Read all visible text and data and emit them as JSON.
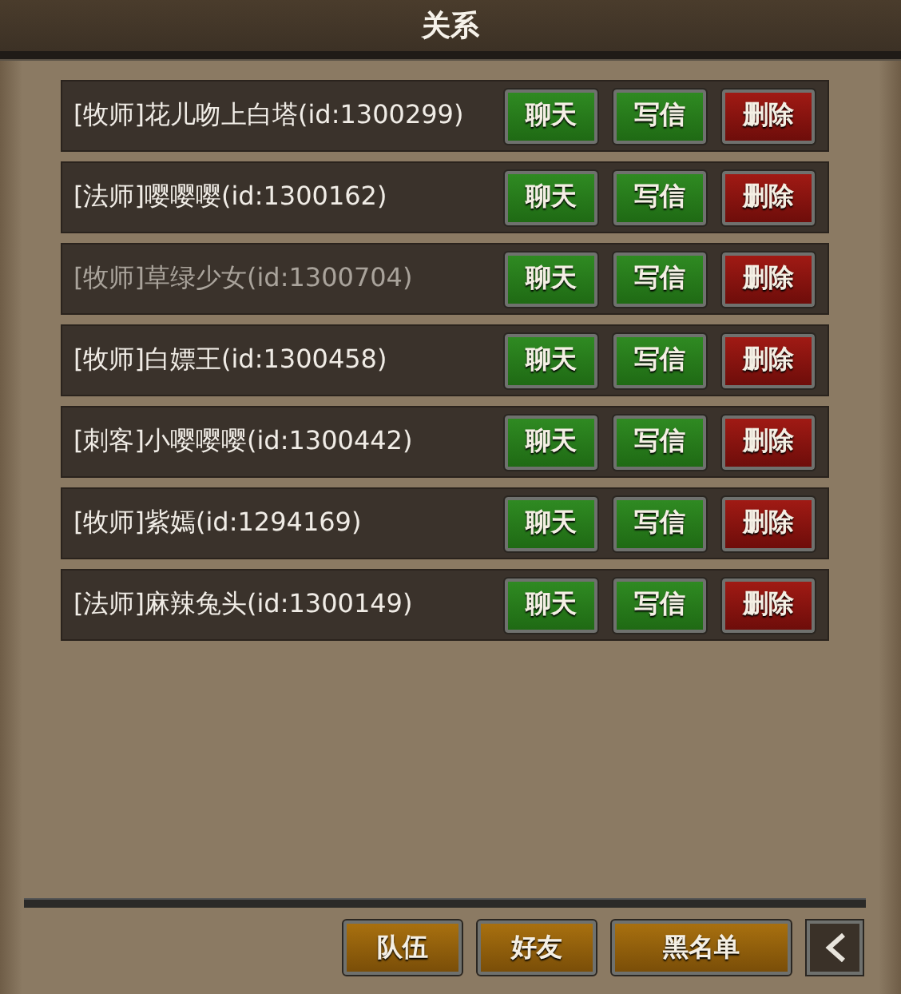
{
  "window": {
    "title": "关系"
  },
  "friends": [
    {
      "name": "[牧师]花儿吻上白塔(id:1300299)",
      "online": true,
      "actions": [
        {
          "label": "聊天",
          "kind": "chat"
        },
        {
          "label": "写信",
          "kind": "mail"
        },
        {
          "label": "删除",
          "kind": "delete"
        }
      ]
    },
    {
      "name": "[法师]嘤嘤嘤(id:1300162)",
      "online": true,
      "actions": [
        {
          "label": "聊天",
          "kind": "chat"
        },
        {
          "label": "写信",
          "kind": "mail"
        },
        {
          "label": "删除",
          "kind": "delete"
        }
      ]
    },
    {
      "name": "[牧师]草绿少女(id:1300704)",
      "online": false,
      "actions": [
        {
          "label": "聊天",
          "kind": "chat"
        },
        {
          "label": "写信",
          "kind": "mail"
        },
        {
          "label": "删除",
          "kind": "delete"
        }
      ]
    },
    {
      "name": "[牧师]白嫖王(id:1300458)",
      "online": true,
      "actions": [
        {
          "label": "聊天",
          "kind": "chat"
        },
        {
          "label": "写信",
          "kind": "mail"
        },
        {
          "label": "删除",
          "kind": "delete"
        }
      ]
    },
    {
      "name": "[刺客]小嘤嘤嘤(id:1300442)",
      "online": true,
      "actions": [
        {
          "label": "聊天",
          "kind": "chat"
        },
        {
          "label": "写信",
          "kind": "mail"
        },
        {
          "label": "删除",
          "kind": "delete"
        }
      ]
    },
    {
      "name": "[牧师]紫嫣(id:1294169)",
      "online": true,
      "actions": [
        {
          "label": "聊天",
          "kind": "chat"
        },
        {
          "label": "写信",
          "kind": "mail"
        },
        {
          "label": "删除",
          "kind": "delete"
        }
      ]
    },
    {
      "name": "[法师]麻辣兔头(id:1300149)",
      "online": true,
      "actions": [
        {
          "label": "聊天",
          "kind": "chat"
        },
        {
          "label": "写信",
          "kind": "mail"
        },
        {
          "label": "删除",
          "kind": "delete"
        }
      ]
    }
  ],
  "tabs": [
    {
      "label": "队伍"
    },
    {
      "label": "好友"
    },
    {
      "label": "黑名单"
    }
  ]
}
